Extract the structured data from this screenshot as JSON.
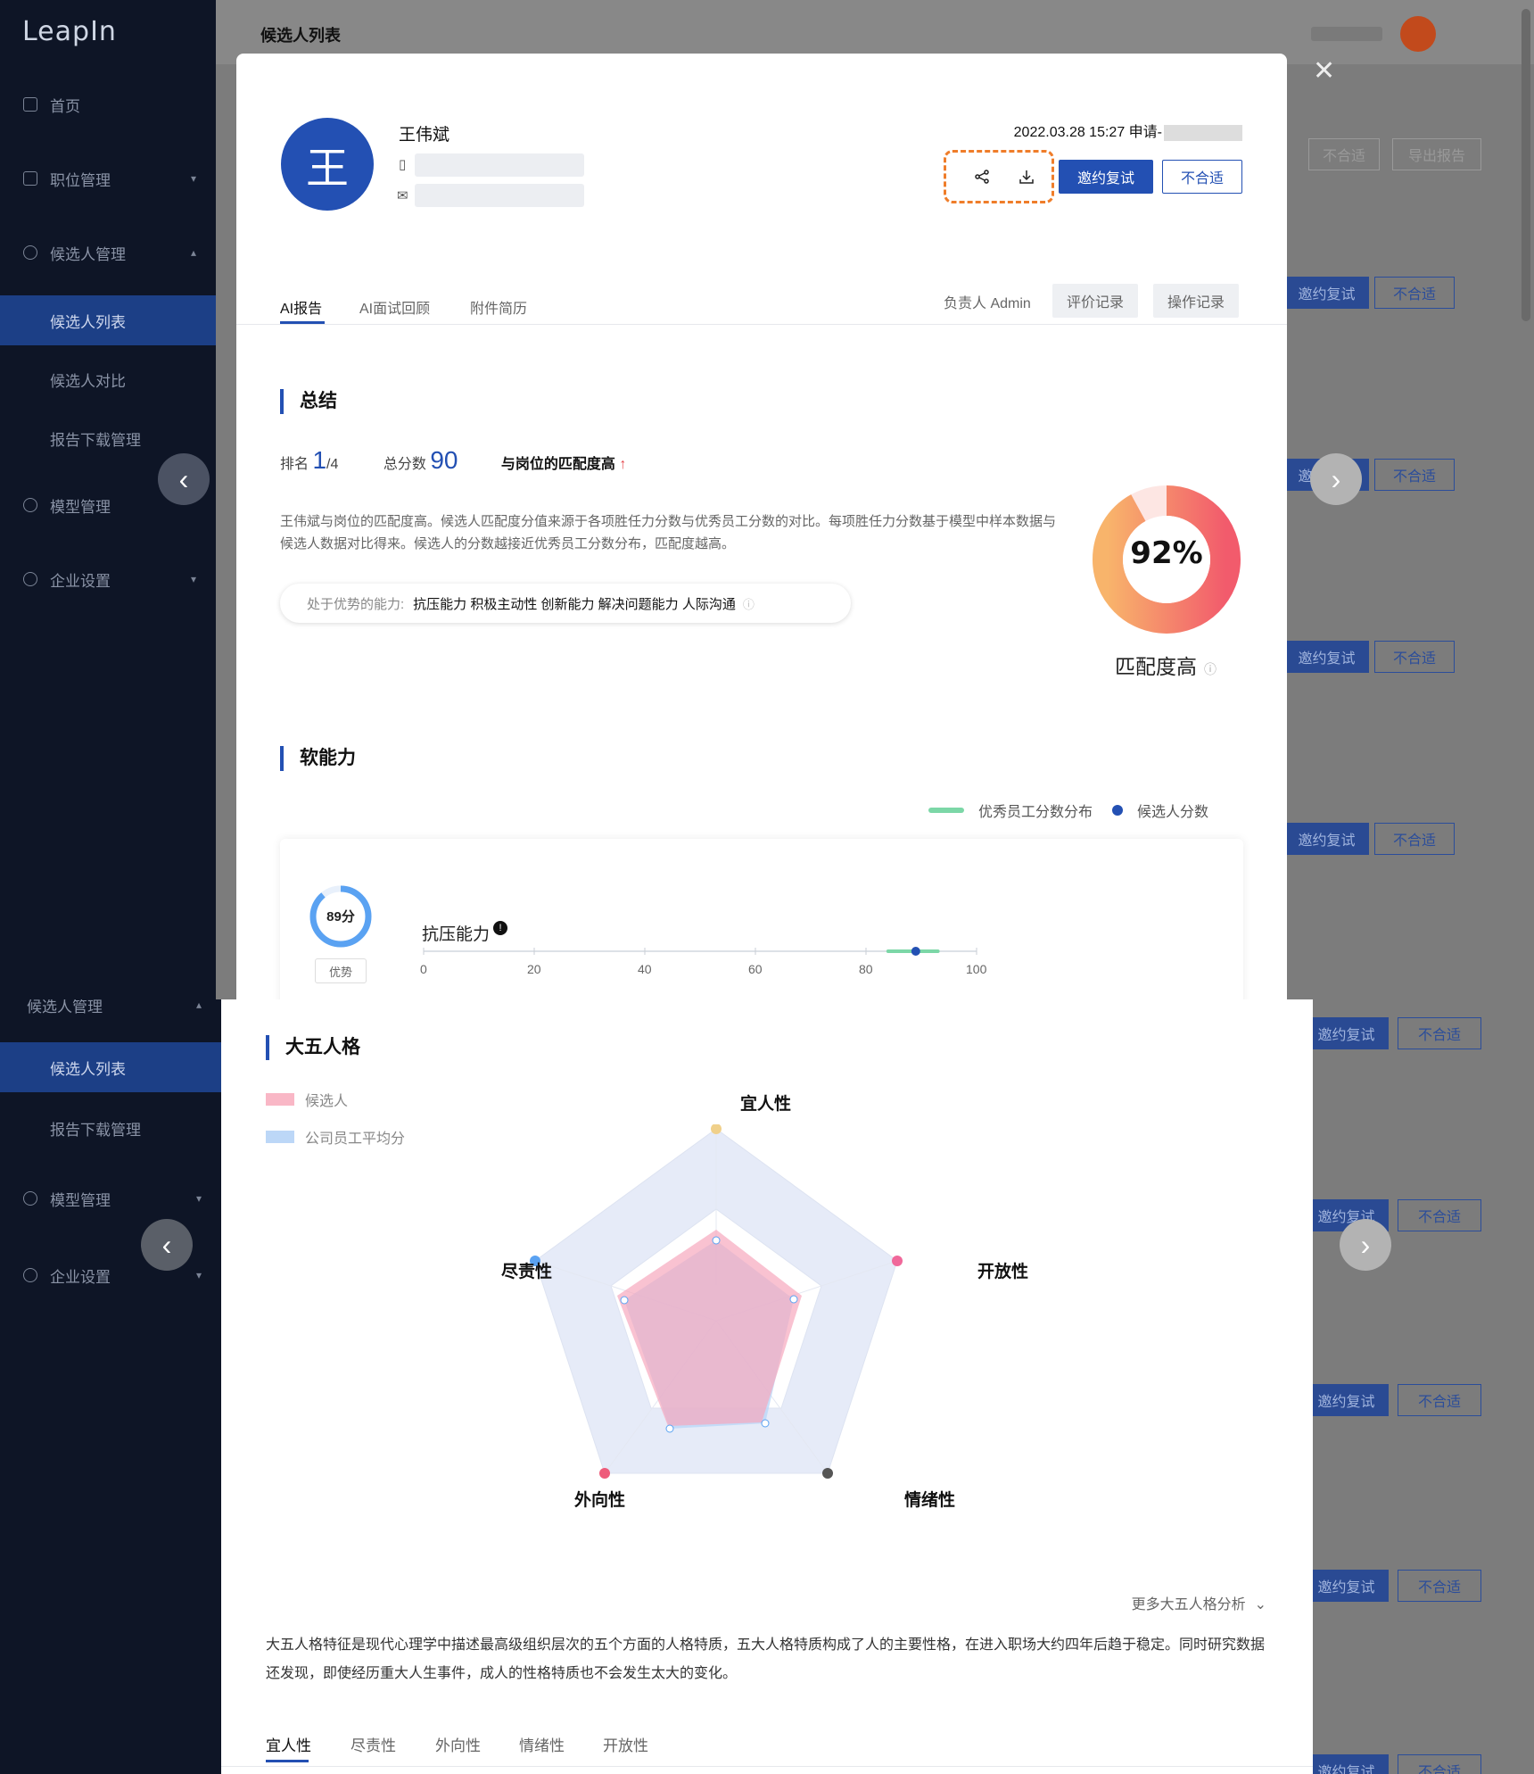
{
  "app": {
    "logo": "LeapIn"
  },
  "sidebar_top": {
    "items": [
      {
        "label": "首页",
        "icon": "home-icon"
      },
      {
        "label": "职位管理",
        "icon": "briefcase-icon"
      },
      {
        "label": "候选人管理",
        "icon": "user-icon"
      },
      {
        "label": "候选人列表"
      },
      {
        "label": "候选人对比"
      },
      {
        "label": "报告下载管理"
      },
      {
        "label": "模型管理",
        "icon": "model-icon"
      },
      {
        "label": "企业设置",
        "icon": "settings-icon"
      }
    ]
  },
  "sidebar_bottom": {
    "items": [
      {
        "label": "候选人管理"
      },
      {
        "label": "候选人列表"
      },
      {
        "label": "报告下载管理"
      },
      {
        "label": "模型管理"
      },
      {
        "label": "企业设置"
      }
    ]
  },
  "page": {
    "title": "候选人列表"
  },
  "background_list": {
    "not_fit": "不合适",
    "export": "导出报告",
    "invite": "邀约复试"
  },
  "candidate": {
    "avatar_char": "王",
    "name": "王伟斌",
    "apply_time": "2022.03.28 15:27 申请-",
    "invite_label": "邀约复试",
    "reject_label": "不合适"
  },
  "tabs": {
    "ai_report": "AI报告",
    "ai_review": "AI面试回顾",
    "resume": "附件简历"
  },
  "owner": "负责人 Admin",
  "eval_log": "评价记录",
  "op_log": "操作记录",
  "summary": {
    "title": "总结",
    "rank_label": "排名",
    "rank_value": "1",
    "rank_total": "/4",
    "total_label": "总分数",
    "total_value": "90",
    "match_label": "与岗位的匹配度高",
    "description": "王伟斌与岗位的匹配度高。候选人匹配度分值来源于各项胜任力分数与优秀员工分数的对比。每项胜任力分数基于模型中样本数据与候选人数据对比得来。候选人的分数越接近优秀员工分数分布，匹配度越高。",
    "strength_label": "处于优势的能力:",
    "strength_value": "抗压能力 积极主动性 创新能力 解决问题能力 人际沟通",
    "match_percent": "92%",
    "match_value": 92,
    "match_text": "匹配度高"
  },
  "soft_skills": {
    "title": "软能力",
    "legend_excellent": "优秀员工分数分布",
    "legend_candidate": "候选人分数",
    "score_text": "89分",
    "score_value": 89,
    "badge": "优势",
    "trait": "抗压能力",
    "axis": [
      "0",
      "20",
      "40",
      "60",
      "80",
      "100"
    ],
    "range": [
      84,
      93
    ],
    "candidate_value": 89
  },
  "big_five": {
    "title": "大五人格",
    "legend_candidate": "候选人",
    "legend_avg": "公司员工平均分",
    "labels": {
      "agreeableness": "宜人性",
      "openness": "开放性",
      "neuroticism": "情绪性",
      "extraversion": "外向性",
      "conscientiousness": "尽责性"
    },
    "more": "更多大五人格分析",
    "paragraph": "大五人格特征是现代心理学中描述最高级组织层次的五个方面的人格特质，五大人格特质构成了人的主要性格，在进入职场大约四年后趋于稳定。同时研究数据还发现，即使经历重大人生事件，成人的性格特质也不会发生太大的变化。",
    "tabs": [
      "宜人性",
      "尽责性",
      "外向性",
      "情绪性",
      "开放性"
    ]
  },
  "colors": {
    "accent": "#2350b3",
    "highlight": "#ef7d2a",
    "donut_start": "#f8b46b",
    "donut_end": "#f25b6c"
  }
}
